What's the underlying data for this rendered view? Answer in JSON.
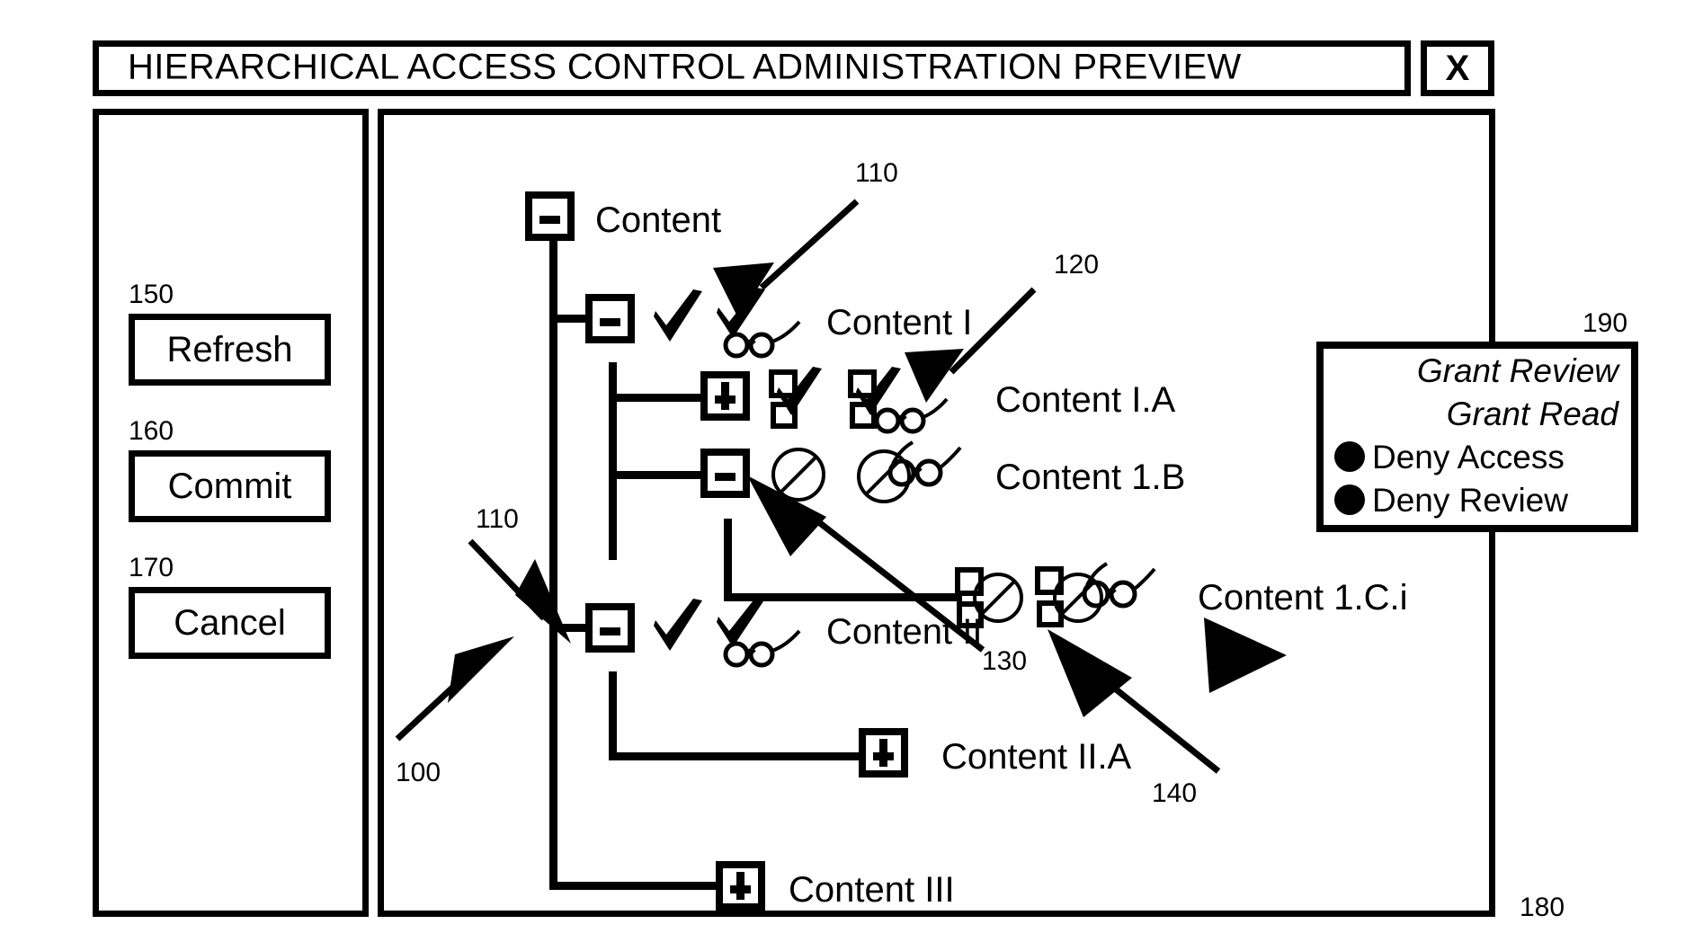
{
  "window": {
    "title": "HIERARCHICAL ACCESS CONTROL ADMINISTRATION PREVIEW",
    "close_label": "X",
    "panel_ref": "180",
    "tree_ref": "100"
  },
  "sidebar": {
    "buttons": [
      {
        "ref": "150",
        "label": "Refresh"
      },
      {
        "ref": "160",
        "label": "Commit"
      },
      {
        "ref": "170",
        "label": "Cancel"
      }
    ]
  },
  "tree": {
    "nodes": [
      {
        "id": "content",
        "label": "Content",
        "expander": "minus",
        "perm_icons": []
      },
      {
        "id": "content-i",
        "label": "Content I",
        "expander": "minus",
        "perm_icons": [
          "check",
          "check-glasses"
        ]
      },
      {
        "id": "content-i-a",
        "label": "Content I.A",
        "expander": "plus",
        "perm_icons": [
          "inherited-check",
          "inherited-check-glasses"
        ]
      },
      {
        "id": "content-1-b",
        "label": "Content 1.B",
        "expander": "minus",
        "perm_icons": [
          "deny",
          "deny-glasses"
        ]
      },
      {
        "id": "content-1-c-i",
        "label": "Content 1.C.i",
        "expander": "none",
        "perm_icons": [
          "inherited-deny",
          "inherited-deny-glasses"
        ]
      },
      {
        "id": "content-ii",
        "label": "Content II",
        "expander": "minus",
        "perm_icons": [
          "check",
          "check-glasses"
        ]
      },
      {
        "id": "content-ii-a",
        "label": "Content II.A",
        "expander": "plus",
        "perm_icons": []
      },
      {
        "id": "content-iii",
        "label": "Content III",
        "expander": "plus",
        "perm_icons": []
      }
    ]
  },
  "callouts": [
    {
      "id": "callout-110-top",
      "text": "110"
    },
    {
      "id": "callout-120",
      "text": "120"
    },
    {
      "id": "callout-110-bottom",
      "text": "110"
    },
    {
      "id": "callout-130",
      "text": "130"
    },
    {
      "id": "callout-140",
      "text": "140"
    }
  ],
  "popup": {
    "ref": "190",
    "items": [
      {
        "label": "Grant Review",
        "state": "disabled",
        "bullet": false
      },
      {
        "label": "Grant Read",
        "state": "disabled",
        "bullet": false
      },
      {
        "label": "Deny Access",
        "state": "enabled",
        "bullet": true
      },
      {
        "label": "Deny Review",
        "state": "enabled",
        "bullet": true
      }
    ]
  },
  "colors": {
    "ink": "#000000",
    "paper": "#ffffff"
  }
}
